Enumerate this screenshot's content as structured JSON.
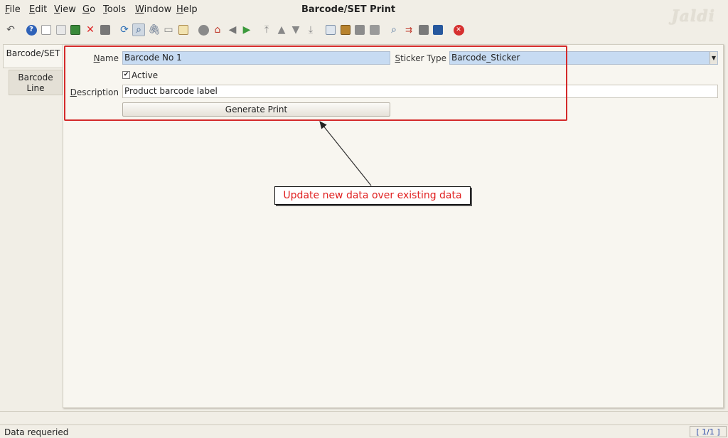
{
  "window": {
    "title": "Barcode/SET Print",
    "logo_text": "Jaldi"
  },
  "menu": [
    {
      "label": "File"
    },
    {
      "label": "Edit"
    },
    {
      "label": "View"
    },
    {
      "label": "Go"
    },
    {
      "label": "Tools"
    },
    {
      "label": "Window"
    },
    {
      "label": "Help"
    }
  ],
  "toolbar": {
    "icons": [
      "undo-icon",
      "help-icon",
      "new-record-icon",
      "copy-record-icon",
      "save-icon",
      "delete-icon",
      "delete-selection-icon",
      "refresh-icon",
      "find-icon",
      "attachment-icon",
      "chat-icon",
      "history-icon",
      "home-icon",
      "parent-record-icon",
      "back-icon",
      "forward-icon",
      "first-record-icon",
      "previous-record-icon",
      "next-record-icon",
      "last-record-icon",
      "report-icon",
      "archive-icon",
      "print-preview-icon",
      "print-icon",
      "zoom-across-icon",
      "workflow-icon",
      "product-info-icon",
      "process-icon",
      "close-window-icon"
    ]
  },
  "tabs": [
    {
      "label": "Barcode/SET"
    },
    {
      "label_line1": "Barcode",
      "label_line2": "Line"
    }
  ],
  "form": {
    "name_label": "Name",
    "name_value": "Barcode No 1",
    "sticker_type_label": "Sticker Type",
    "sticker_type_value": "Barcode_Sticker",
    "active_label": "Active",
    "active_checked": true,
    "description_label": "Description",
    "description_value": "Product barcode label",
    "generate_button": "Generate Print"
  },
  "annotation": {
    "callout_text": "Update new data over existing data",
    "highlight_color": "#d42a2a"
  },
  "status": {
    "message": "Data requeried",
    "record_counter": "[ 1/1 ]"
  }
}
